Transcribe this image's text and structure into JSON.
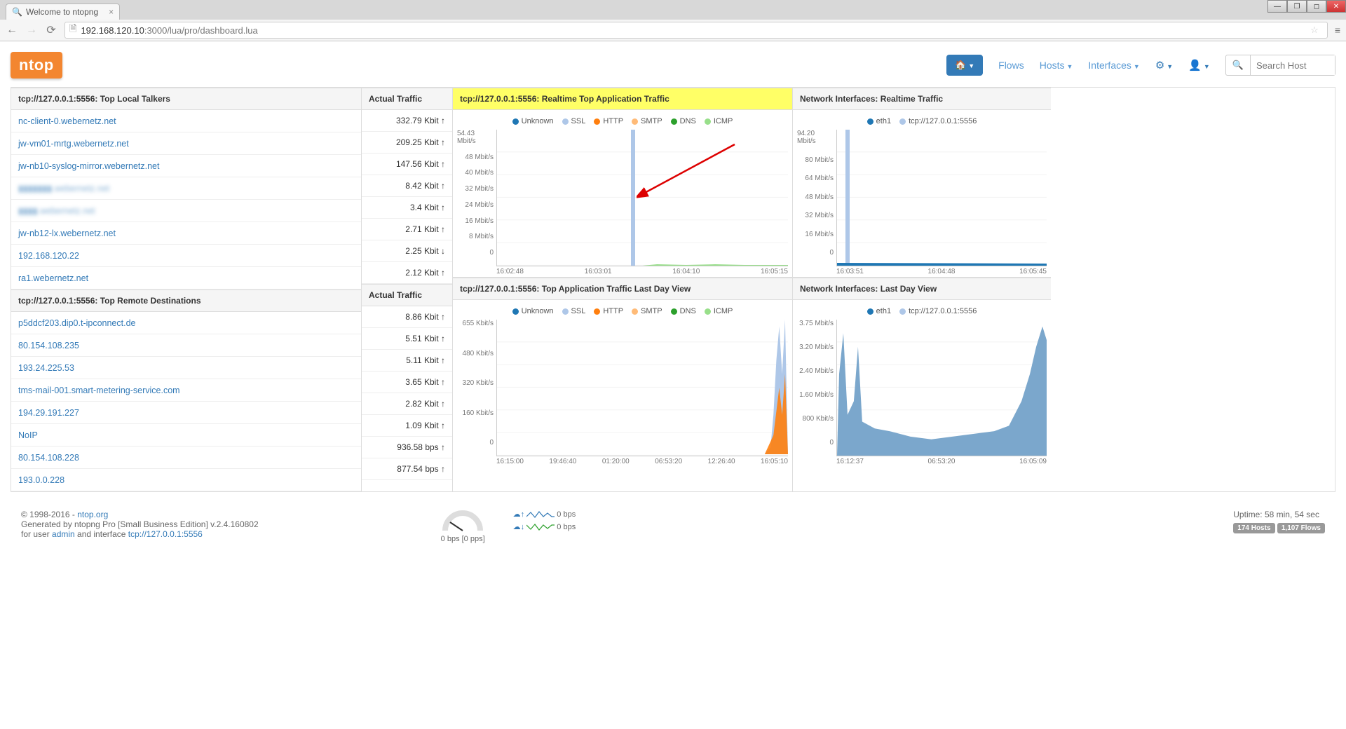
{
  "browser": {
    "tab_title": "Welcome to ntopng",
    "url_host": "192.168.120.10",
    "url_port_path": ":3000/lua/pro/dashboard.lua"
  },
  "nav": {
    "logo": "ntop",
    "flows": "Flows",
    "hosts": "Hosts",
    "interfaces": "Interfaces",
    "search_placeholder": "Search Host"
  },
  "panels": {
    "talkers_title": "tcp://127.0.0.1:5556: Top Local Talkers",
    "actual_traffic": "Actual Traffic",
    "remote_title": "tcp://127.0.0.1:5556: Top Remote Destinations",
    "app_rt_title": "tcp://127.0.0.1:5556: Realtime Top Application Traffic",
    "app_day_title": "tcp://127.0.0.1:5556: Top Application Traffic Last Day View",
    "if_rt_title": "Network Interfaces: Realtime Traffic",
    "if_day_title": "Network Interfaces: Last Day View"
  },
  "talkers": [
    {
      "host": "nc-client-0.webernetz.net",
      "val": "332.79 Kbit",
      "dir": "↑"
    },
    {
      "host": "jw-vm01-mrtg.webernetz.net",
      "val": "209.25 Kbit",
      "dir": "↑"
    },
    {
      "host": "jw-nb10-syslog-mirror.webernetz.net",
      "val": "147.56 Kbit",
      "dir": "↑"
    },
    {
      "host": "▮▮▮▮▮▮▮.webernetz.net",
      "val": "8.42 Kbit",
      "dir": "↑",
      "blur": true
    },
    {
      "host": "▮▮▮▮.webernetz.net",
      "val": "3.4 Kbit",
      "dir": "↑",
      "blur": true
    },
    {
      "host": "jw-nb12-lx.webernetz.net",
      "val": "2.71 Kbit",
      "dir": "↑"
    },
    {
      "host": "192.168.120.22",
      "val": "2.25 Kbit",
      "dir": "↓"
    },
    {
      "host": "ra1.webernetz.net",
      "val": "2.12 Kbit",
      "dir": "↑"
    }
  ],
  "remotes": [
    {
      "host": "p5ddcf203.dip0.t-ipconnect.de",
      "val": "8.86 Kbit",
      "dir": "↑"
    },
    {
      "host": "80.154.108.235",
      "val": "5.51 Kbit",
      "dir": "↑"
    },
    {
      "host": "193.24.225.53",
      "val": "5.11 Kbit",
      "dir": "↑"
    },
    {
      "host": "tms-mail-001.smart-metering-service.com",
      "val": "3.65 Kbit",
      "dir": "↑"
    },
    {
      "host": "194.29.191.227",
      "val": "2.82 Kbit",
      "dir": "↑"
    },
    {
      "host": "NoIP",
      "val": "1.09 Kbit",
      "dir": "↑"
    },
    {
      "host": "80.154.108.228",
      "val": "936.58 bps",
      "dir": "↑"
    },
    {
      "host": "193.0.0.228",
      "val": "877.54 bps",
      "dir": "↑"
    }
  ],
  "legend_app": [
    {
      "name": "Unknown",
      "color": "#1f77b4"
    },
    {
      "name": "SSL",
      "color": "#aec7e8"
    },
    {
      "name": "HTTP",
      "color": "#ff7f0e"
    },
    {
      "name": "SMTP",
      "color": "#ffbb78"
    },
    {
      "name": "DNS",
      "color": "#2ca02c"
    },
    {
      "name": "ICMP",
      "color": "#98df8a"
    }
  ],
  "legend_if": [
    {
      "name": "eth1",
      "color": "#1f77b4"
    },
    {
      "name": "tcp://127.0.0.1:5556",
      "color": "#aec7e8"
    }
  ],
  "chart_data": [
    {
      "id": "app_realtime",
      "type": "area",
      "title": "tcp://127.0.0.1:5556: Realtime Top Application Traffic",
      "ylabel": "Mbit/s",
      "ylim": [
        0,
        54.43
      ],
      "yticks": [
        "54.43 Mbit/s",
        "48 Mbit/s",
        "40 Mbit/s",
        "32 Mbit/s",
        "24 Mbit/s",
        "16 Mbit/s",
        "8 Mbit/s",
        "0"
      ],
      "xticks": [
        "16:02:48",
        "16:03:01",
        "16:04:10",
        "16:05:15"
      ],
      "series": [
        {
          "name": "SSL",
          "peak_time": "16:03:01",
          "peak_value": 54.43
        }
      ],
      "note": "single tall SSL spike near 16:03, near-zero otherwise"
    },
    {
      "id": "if_realtime",
      "type": "area",
      "title": "Network Interfaces: Realtime Traffic",
      "ylabel": "Mbit/s",
      "ylim": [
        0,
        94.2
      ],
      "yticks": [
        "94.20 Mbit/s",
        "80 Mbit/s",
        "64 Mbit/s",
        "48 Mbit/s",
        "32 Mbit/s",
        "16 Mbit/s",
        "0"
      ],
      "xticks": [
        "16:03:51",
        "16:04:48",
        "16:05:45"
      ],
      "series": [
        {
          "name": "tcp://127.0.0.1:5556",
          "peak_value": 94.2
        }
      ],
      "note": "single spike at far left then low baseline"
    },
    {
      "id": "app_lastday",
      "type": "area",
      "title": "tcp://127.0.0.1:5556: Top Application Traffic Last Day View",
      "ylabel": "Kbit/s",
      "ylim": [
        0,
        655
      ],
      "yticks": [
        "655 Kbit/s",
        "480 Kbit/s",
        "320 Kbit/s",
        "160 Kbit/s",
        "0"
      ],
      "xticks": [
        "16:15:00",
        "19:46:40",
        "01:20:00",
        "06:53:20",
        "12:26:40",
        "16:05:10"
      ],
      "note": "flat low then sharp multi-protocol spike at far right"
    },
    {
      "id": "if_lastday",
      "type": "area",
      "title": "Network Interfaces: Last Day View",
      "ylabel": "Mbit/s",
      "ylim": [
        0,
        3.75
      ],
      "yticks": [
        "3.75 Mbit/s",
        "3.20 Mbit/s",
        "2.40 Mbit/s",
        "1.60 Mbit/s",
        "800 Kbit/s",
        "0"
      ],
      "xticks": [
        "16:12:37",
        "06:53:20",
        "16:05:09"
      ],
      "note": "noisy baseline ~0.5-1 Mbit/s with spikes at start and end"
    }
  ],
  "footer": {
    "copyright": "© 1998-2016 - ",
    "ntop_link": "ntop.org",
    "generated": "Generated by ntopng Pro [Small Business Edition] v.2.4.160802",
    "foruser_pre": "for user ",
    "user": "admin",
    "foruser_mid": " and interface ",
    "iface": "tcp://127.0.0.1:5556",
    "gauge_label": "0 bps [0 pps]",
    "up_bps": "0 bps",
    "down_bps": "0 bps",
    "uptime": "Uptime: 58 min, 54 sec",
    "badge_hosts": "174 Hosts",
    "badge_flows": "1,107 Flows"
  }
}
